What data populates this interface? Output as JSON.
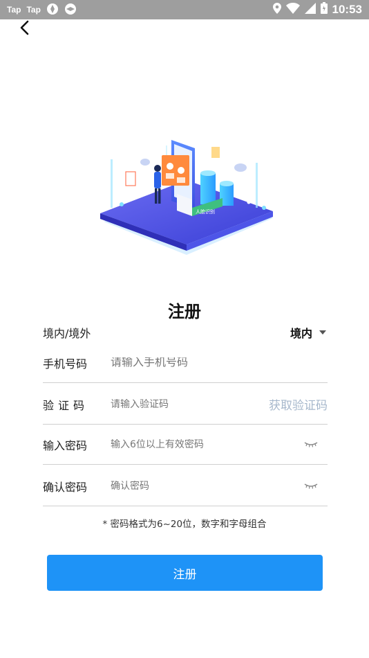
{
  "status_bar": {
    "app_labels": [
      "Tap",
      "Tap"
    ],
    "time": "10:53",
    "icons": [
      "taptap-icon",
      "aperture-icon",
      "aperture-icon",
      "location-icon",
      "wifi-icon",
      "signal-icon",
      "battery-icon"
    ]
  },
  "header": {
    "back_icon": "chevron-left-icon"
  },
  "illustration": {
    "badge_text": "人脸识别"
  },
  "form": {
    "title": "注册",
    "region": {
      "label": "境内/境外",
      "selected": "境内"
    },
    "phone": {
      "label": "手机号码",
      "placeholder": "请输入手机号码"
    },
    "code": {
      "label": "验证码",
      "placeholder": "请输入验证码",
      "get_code_label": "获取验证码"
    },
    "password": {
      "label": "输入密码",
      "placeholder": "输入6位以上有效密码"
    },
    "confirm": {
      "label": "确认密码",
      "placeholder": "确认密码"
    },
    "hint": "* 密码格式为6~20位，数字和字母组合",
    "submit_label": "注册"
  },
  "colors": {
    "primary": "#1e93f7",
    "link_disabled": "#a7b8cc",
    "status_bar": "#9e9e9e"
  }
}
